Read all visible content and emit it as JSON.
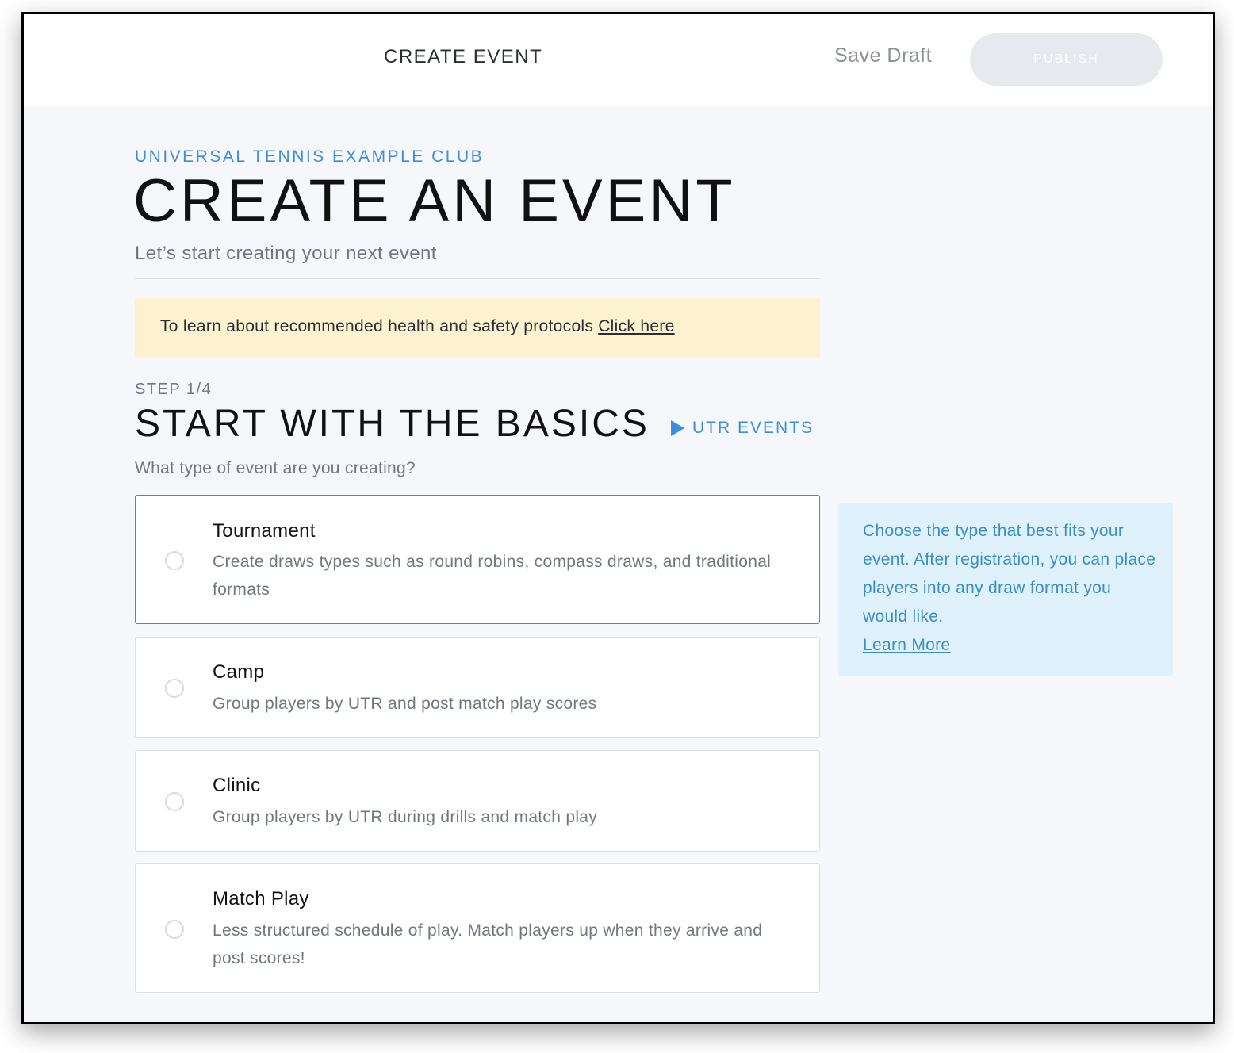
{
  "topbar": {
    "title": "CREATE EVENT",
    "save_draft_label": "Save Draft",
    "publish_label": "PUBLISH"
  },
  "header": {
    "club_name": "UNIVERSAL TENNIS EXAMPLE CLUB",
    "page_title": "CREATE AN EVENT",
    "subtitle": "Let’s start creating your next event"
  },
  "banner": {
    "text": "To learn about recommended health and safety protocols",
    "link_label": "Click here"
  },
  "step": {
    "label": "STEP 1/4",
    "title": "START WITH THE BASICS",
    "utr_events_label": "UTR EVENTS",
    "question": "What type of event are you creating?"
  },
  "options": [
    {
      "title": "Tournament",
      "description": "Create draws types such as round robins, compass draws, and traditional formats"
    },
    {
      "title": "Camp",
      "description": "Group players by UTR and post match play scores"
    },
    {
      "title": "Clinic",
      "description": "Group players by UTR during drills and match play"
    },
    {
      "title": "Match Play",
      "description": "Less structured schedule of play. Match players up when they arrive and post scores!"
    }
  ],
  "info": {
    "text": "Choose the type that best fits your event. After registration, you can place players into any draw format you would like.",
    "link_label": "Learn More"
  },
  "colors": {
    "accent_blue": "#3c8fde",
    "banner_bg": "#fdf2d0",
    "info_bg": "#dff1fa",
    "publish_disabled": "#e6e9ee"
  }
}
